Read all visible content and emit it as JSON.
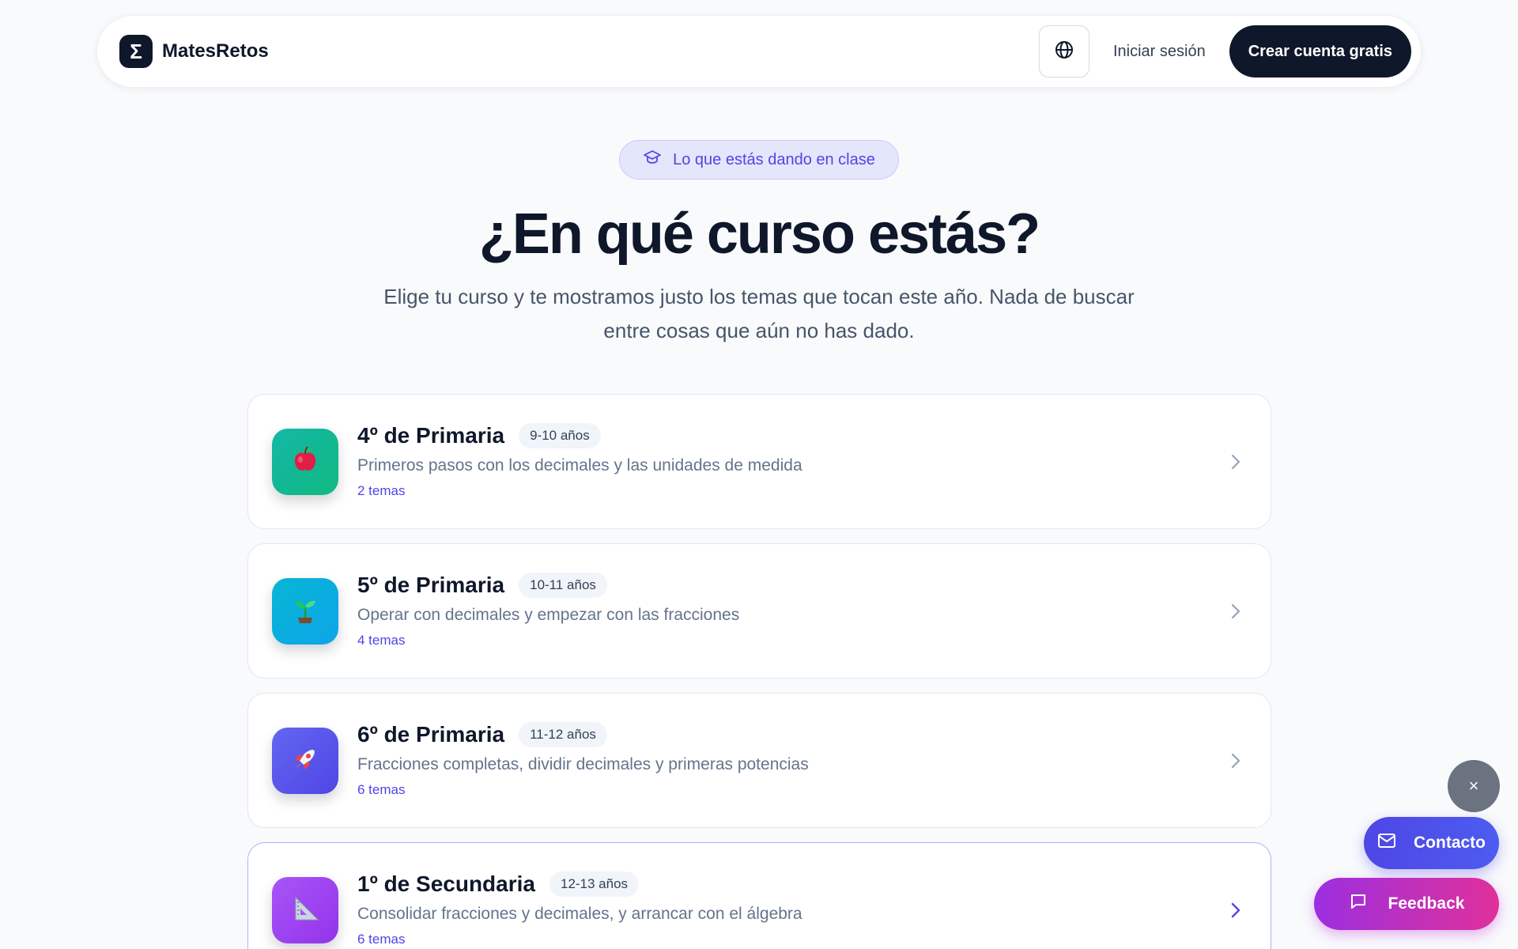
{
  "header": {
    "brand_symbol": "Σ",
    "brand_name": "MatesRetos",
    "login_label": "Iniciar sesión",
    "signup_label": "Crear cuenta gratis"
  },
  "hero": {
    "pill_text": "Lo que estás dando en clase",
    "title": "¿En qué curso estás?",
    "subtitle_line1": "Elige tu curso y te mostramos justo los temas que tocan este año. Nada de buscar",
    "subtitle_line2": "entre cosas que aún no has dado."
  },
  "courses": [
    {
      "title": "4º de Primaria",
      "age": "9-10 años",
      "description": "Primeros pasos con los decimales y las unidades de medida",
      "topics": "2 temas",
      "icon": "apple-icon",
      "color": "#14b8a6"
    },
    {
      "title": "5º de Primaria",
      "age": "10-11 años",
      "description": "Operar con decimales y empezar con las fracciones",
      "topics": "4 temas",
      "icon": "sprout-icon",
      "color": "#0ea5e9"
    },
    {
      "title": "6º de Primaria",
      "age": "11-12 años",
      "description": "Fracciones completas, dividir decimales y primeras potencias",
      "topics": "6 temas",
      "icon": "rocket-icon",
      "color": "#4f46e5"
    },
    {
      "title": "1º de Secundaria",
      "age": "12-13 años",
      "description": "Consolidar fracciones y decimales, y arrancar con el álgebra",
      "topics": "6 temas",
      "icon": "triangle-ruler-icon",
      "color": "#9333ea"
    }
  ],
  "widgets": {
    "close_symbol": "×",
    "contact_label": "Contacto",
    "feedback_label": "Feedback"
  }
}
